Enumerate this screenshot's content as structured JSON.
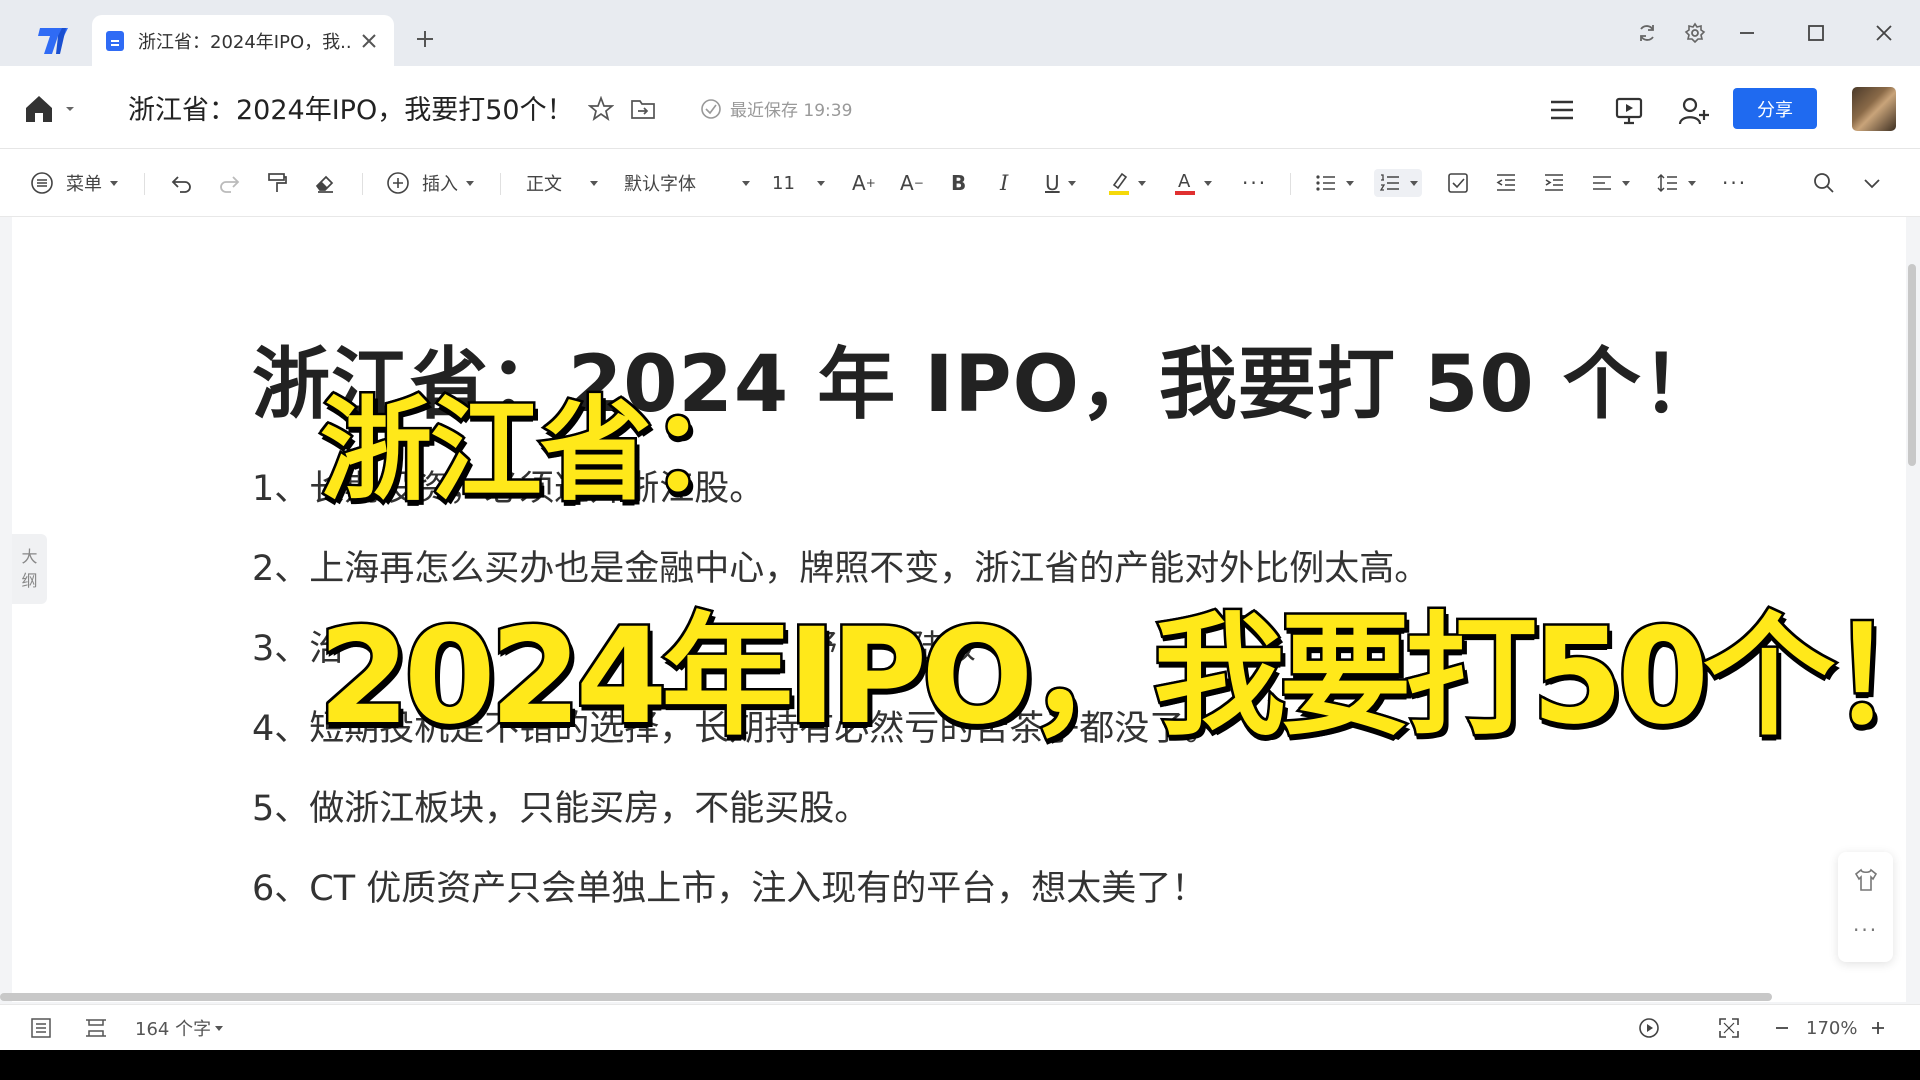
{
  "tabbar": {
    "tab_title": "浙江省：2024年IPO，我...",
    "icons": [
      "app-logo-icon",
      "doc-icon",
      "close-icon",
      "plus-icon",
      "sync-icon",
      "settings-icon",
      "minimize-icon",
      "maximize-icon",
      "window-close-icon"
    ]
  },
  "header": {
    "doc_title": "浙江省：2024年IPO，我要打50个！",
    "save_status": "最近保存 19:39",
    "share_label": "分享"
  },
  "toolbar": {
    "menu_label": "菜单",
    "insert_label": "插入",
    "style_value": "正文",
    "font_value": "默认字体",
    "size_value": "11"
  },
  "document": {
    "heading": "浙江省：2024 年 IPO，我要打 50 个！",
    "items": [
      "1、长期投资，必须避开浙江股。",
      "2、上海再怎么买办也是金融中心，牌照不变，浙江省的产能对外比例太高。",
      "3、治",
      "4、短期投机是不错的选择，长期持有必然亏的苦茶子都没了。",
      "5、做浙江板块，只能买房，不能买股。",
      "6、CT 优质资产只会单独上市，注入现有的平台，想太美了！"
    ],
    "item3_fragments": [
      "野",
      "陆贩"
    ],
    "outline_label_1": "大",
    "outline_label_2": "纲"
  },
  "overlay": {
    "caption_line1": "浙江省：",
    "caption_line2": "2024年IPO，我要打50个！"
  },
  "statusbar": {
    "word_count": "164 个字",
    "zoom": "170%"
  },
  "colors": {
    "accent": "#1f6af0",
    "caption_fill": "#ffe81a",
    "caption_stroke": "#000000",
    "highlight_bar": "#f5d90a",
    "font_color_bar": "#e03030"
  }
}
